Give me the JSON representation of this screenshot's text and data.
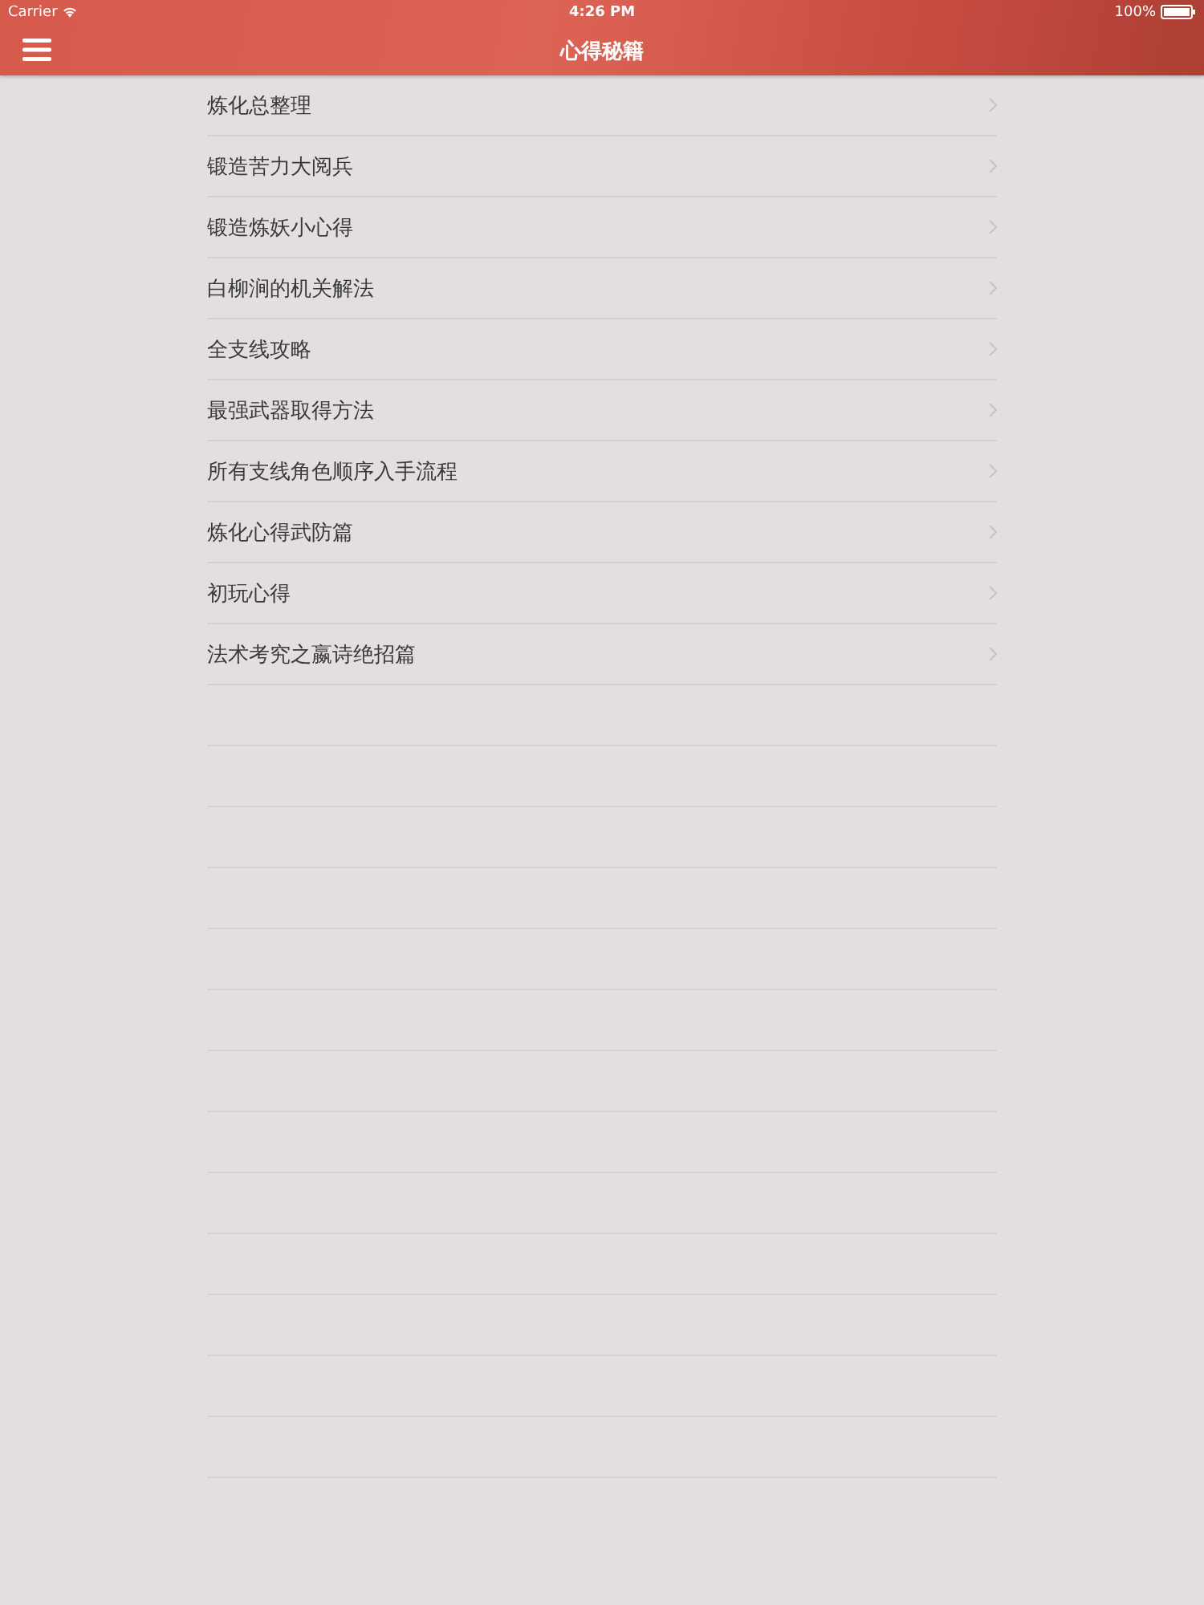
{
  "status_bar": {
    "carrier": "Carrier",
    "time": "4:26 PM",
    "battery": "100%"
  },
  "nav_bar": {
    "title": "心得秘籍"
  },
  "list": {
    "items": [
      {
        "label": "炼化总整理"
      },
      {
        "label": "锻造苦力大阅兵"
      },
      {
        "label": "锻造炼妖小心得"
      },
      {
        "label": "白柳涧的机关解法"
      },
      {
        "label": "全支线攻略"
      },
      {
        "label": "最强武器取得方法"
      },
      {
        "label": "所有支线角色顺序入手流程"
      },
      {
        "label": "炼化心得武防篇"
      },
      {
        "label": "初玩心得"
      },
      {
        "label": "法术考究之嬴诗绝招篇"
      }
    ]
  }
}
